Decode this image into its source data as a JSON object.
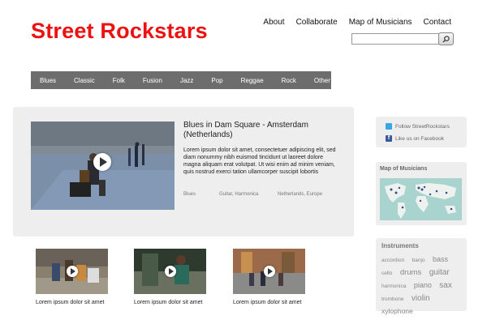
{
  "header": {
    "logo": "Street Rockstars",
    "nav": [
      "About",
      "Collaborate",
      "Map of Musicians",
      "Contact"
    ],
    "search_placeholder": ""
  },
  "genres": [
    "Blues",
    "Classic",
    "Folk",
    "Fusion",
    "Jazz",
    "Pop",
    "Reggae",
    "Rock",
    "Other"
  ],
  "featured": {
    "title": "Blues in Dam Square - Amsterdam (Netherlands)",
    "text": "Lorem ipsum dolor sit amet, consectetuer adipiscing elit, sed diam nonummy nibh euismod tincidunt ut laoreet dolore magna aliquam erat volutpat. Ut wisi enim ad minim veniam, quis nostrud exerci tation ullamcorper suscipit lobortis",
    "genre": "Blues",
    "instruments": "Guitar, Harmonica",
    "location": "Netherlands, Europe"
  },
  "sidebar": {
    "twitter": "Follow StreetRockstars",
    "facebook": "Like us on Facebook",
    "map_title": "Map of Musicians",
    "instruments_title": "Instruments",
    "tags": [
      {
        "label": "accordion",
        "size": "6.5px"
      },
      {
        "label": "banjo",
        "size": "6.5px"
      },
      {
        "label": "bass",
        "size": "9px"
      },
      {
        "label": "cello",
        "size": "6.5px"
      },
      {
        "label": "drums",
        "size": "9.5px"
      },
      {
        "label": "guitar",
        "size": "10px"
      },
      {
        "label": "harmonica",
        "size": "6.5px"
      },
      {
        "label": "piano",
        "size": "9px"
      },
      {
        "label": "sax",
        "size": "10px"
      },
      {
        "label": "trombone",
        "size": "6.5px"
      },
      {
        "label": "violin",
        "size": "10px"
      },
      {
        "label": "xylophone",
        "size": "8.5px"
      }
    ]
  },
  "thumbnails": [
    {
      "caption": "Lorem ipsum dolor sit amet"
    },
    {
      "caption": "Lorem ipsum dolor sit amet"
    },
    {
      "caption": "Lorem ipsum dolor sit amet"
    }
  ],
  "colors": {
    "logo": "#ee1111",
    "genre_bar": "#6d6d6d",
    "panel": "#eeeeee"
  }
}
